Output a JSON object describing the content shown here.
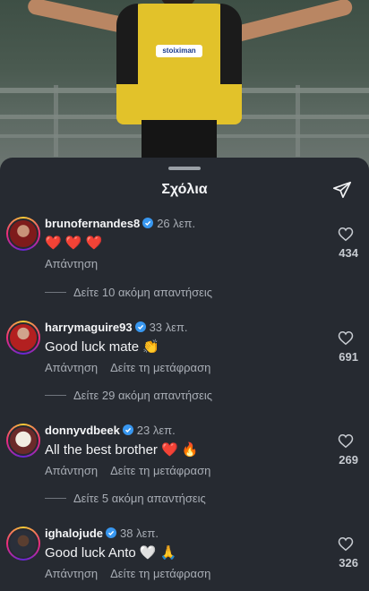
{
  "sheet": {
    "title": "Σχόλια",
    "send_icon": "send-icon"
  },
  "photo": {
    "sponsor": "stoiximan"
  },
  "comments": [
    {
      "username": "brunofernandes8",
      "verified": true,
      "time": "26 λεπ.",
      "text": "❤️ ❤️ ❤️",
      "reply": "Απάντηση",
      "translate": "",
      "likes": "434",
      "more_replies": "Δείτε 10 ακόμη απαντήσεις"
    },
    {
      "username": "harrymaguire93",
      "verified": true,
      "time": "33 λεπ.",
      "text": "Good luck mate 👏",
      "reply": "Απάντηση",
      "translate": "Δείτε τη μετάφραση",
      "likes": "691",
      "more_replies": "Δείτε 29 ακόμη απαντήσεις"
    },
    {
      "username": "donnyvdbeek",
      "verified": true,
      "time": "23 λεπ.",
      "text": "All the best brother ❤️ 🔥",
      "reply": "Απάντηση",
      "translate": "Δείτε τη μετάφραση",
      "likes": "269",
      "more_replies": "Δείτε 5 ακόμη απαντήσεις"
    },
    {
      "username": "ighalojude",
      "verified": true,
      "time": "38 λεπ.",
      "text": "Good luck Anto 🤍 🙏",
      "reply": "Απάντηση",
      "translate": "Δείτε τη μετάφραση",
      "likes": "326",
      "more_replies": ""
    }
  ]
}
